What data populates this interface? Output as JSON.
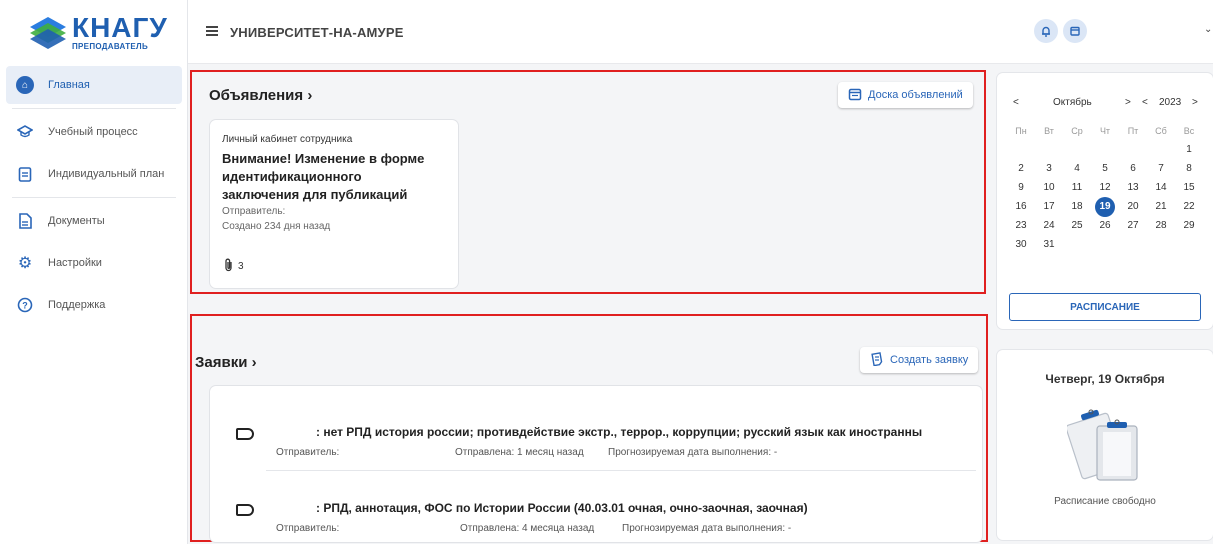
{
  "logo": {
    "big": "КНАГУ",
    "small": "ПРЕПОДАВАТЕЛЬ"
  },
  "sidebar": {
    "items": [
      {
        "label": "Главная",
        "icon": "home-icon"
      },
      {
        "label": "Учебный процесс",
        "icon": "graduation-cap-icon"
      },
      {
        "label": "Индивидуальный план",
        "icon": "clipboard-icon"
      },
      {
        "label": "Документы",
        "icon": "document-icon"
      },
      {
        "label": "Настройки",
        "icon": "gear-icon"
      },
      {
        "label": "Поддержка",
        "icon": "help-icon"
      }
    ]
  },
  "header": {
    "title": "УНИВЕРСИТЕТ-НА-АМУРЕ"
  },
  "announcements": {
    "title": "Объявления",
    "board_button": "Доска объявлений",
    "card": {
      "source": "Личный кабинет сотрудника",
      "title": "Внимание! Изменение в форме идентификационного заключения для публикаций",
      "sender": "Отправитель:",
      "created": "Создано 234 дня назад",
      "attachments": "3"
    }
  },
  "requests": {
    "title": "Заявки",
    "create_button": "Создать заявку",
    "items": [
      {
        "title": ": нет РПД история россии; противдействие экстр., террор., коррупции; русский язык как иностранны",
        "sender": "Отправитель:",
        "sent": "Отправлена: 1 месяц назад",
        "due": "Прогнозируемая дата выполнения: -"
      },
      {
        "title": ": РПД, аннотация, ФОС по Истории России (40.03.01 очная, очно-заочная, заочная)",
        "sender": "Отправитель:",
        "sent": "Отправлена: 4 месяца назад",
        "due": "Прогнозируемая дата выполнения: -"
      }
    ]
  },
  "calendar": {
    "prev": "<",
    "month": "Октябрь",
    "next": ">",
    "year_prev": "<",
    "year": "2023",
    "year_next": ">",
    "weekdays": [
      "Пн",
      "Вт",
      "Ср",
      "Чт",
      "Пт",
      "Сб",
      "Вс"
    ],
    "weeks": [
      [
        "",
        "",
        "",
        "",
        "",
        "",
        "1"
      ],
      [
        "2",
        "3",
        "4",
        "5",
        "6",
        "7",
        "8"
      ],
      [
        "9",
        "10",
        "11",
        "12",
        "13",
        "14",
        "15"
      ],
      [
        "16",
        "17",
        "18",
        "19",
        "20",
        "21",
        "22"
      ],
      [
        "23",
        "24",
        "25",
        "26",
        "27",
        "28",
        "29"
      ],
      [
        "30",
        "31",
        "",
        "",
        "",
        "",
        ""
      ]
    ],
    "selected": "19",
    "schedule_button": "РАСПИСАНИЕ"
  },
  "day_panel": {
    "title": "Четверг, 19 Октября",
    "status": "Расписание свободно"
  },
  "colors": {
    "accent": "#1f5fb0",
    "highlight_border": "#e02020"
  }
}
